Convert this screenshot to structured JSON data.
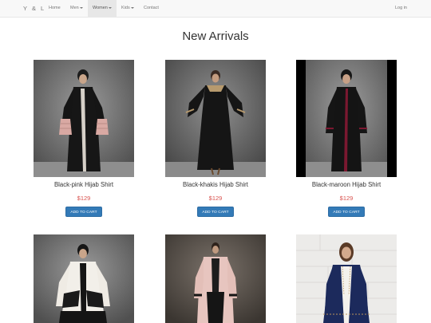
{
  "nav": {
    "brand": "Y & L",
    "items": [
      {
        "label": "Home",
        "dropdown": false,
        "active": false
      },
      {
        "label": "Men",
        "dropdown": true,
        "active": false
      },
      {
        "label": "Women",
        "dropdown": true,
        "active": true
      },
      {
        "label": "Kids",
        "dropdown": true,
        "active": false
      },
      {
        "label": "Contact",
        "dropdown": false,
        "active": false
      }
    ],
    "login": "Log in"
  },
  "page": {
    "title": "New Arrivals"
  },
  "products": [
    {
      "name": "Black-pink Hijab Shirt",
      "price": "$129",
      "button": "ADD TO CART"
    },
    {
      "name": "Black-khakis Hijab Shirt",
      "price": "$129",
      "button": "ADD TO CART"
    },
    {
      "name": "Black-maroon Hijab Shirt",
      "price": "$129",
      "button": "ADD TO CART"
    },
    {
      "name": "",
      "price": "",
      "button": ""
    },
    {
      "name": "",
      "price": "",
      "button": ""
    },
    {
      "name": "",
      "price": "",
      "button": ""
    }
  ],
  "colors": {
    "accent": "#337ab7",
    "price": "#d9534f",
    "navbar_bg": "#f8f8f8"
  }
}
